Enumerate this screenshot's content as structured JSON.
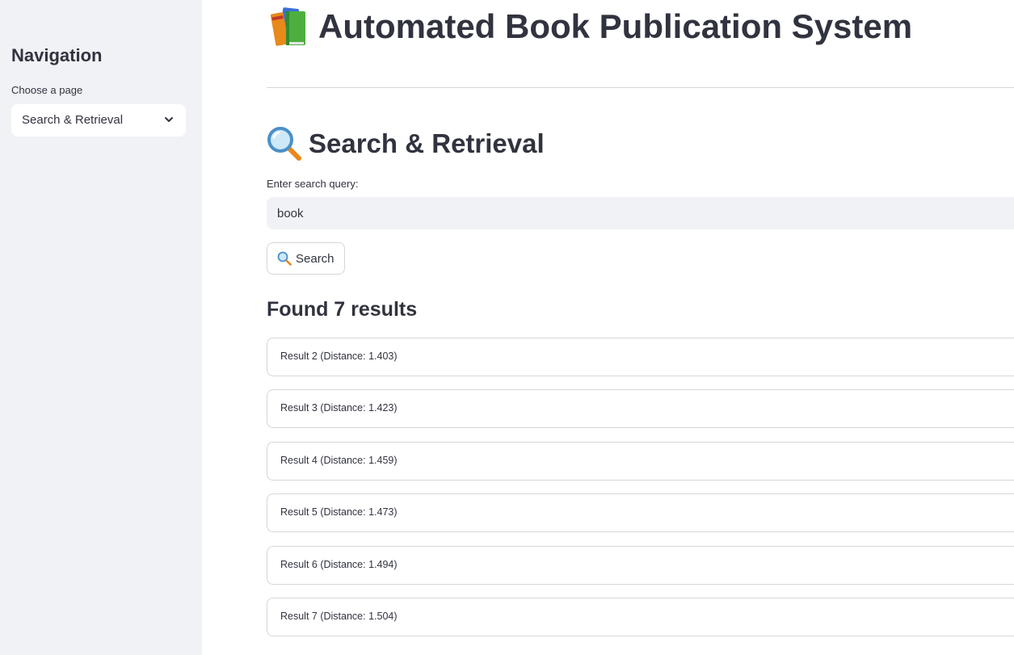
{
  "sidebar": {
    "title": "Navigation",
    "select_label": "Choose a page",
    "selected_page": "Search & Retrieval",
    "chevron_icon": "chevron-down-icon"
  },
  "header": {
    "icon": "books-icon",
    "title": "Automated Book Publication System"
  },
  "page": {
    "icon": "magnifier-icon",
    "title": "Search & Retrieval"
  },
  "search": {
    "label": "Enter search query:",
    "value": "book",
    "button_icon": "magnifier-icon",
    "button_label": "Search"
  },
  "results": {
    "heading": "Found 7 results",
    "items": [
      {
        "label": "Result 2 (Distance: 1.403)"
      },
      {
        "label": "Result 3 (Distance: 1.423)"
      },
      {
        "label": "Result 4 (Distance: 1.459)"
      },
      {
        "label": "Result 5 (Distance: 1.473)"
      },
      {
        "label": "Result 6 (Distance: 1.494)"
      },
      {
        "label": "Result 7 (Distance: 1.504)"
      }
    ]
  },
  "colors": {
    "sidebar_bg": "#f0f2f6",
    "text": "#31333f",
    "border": "#d6d6d9",
    "input_bg": "#f0f2f6"
  }
}
